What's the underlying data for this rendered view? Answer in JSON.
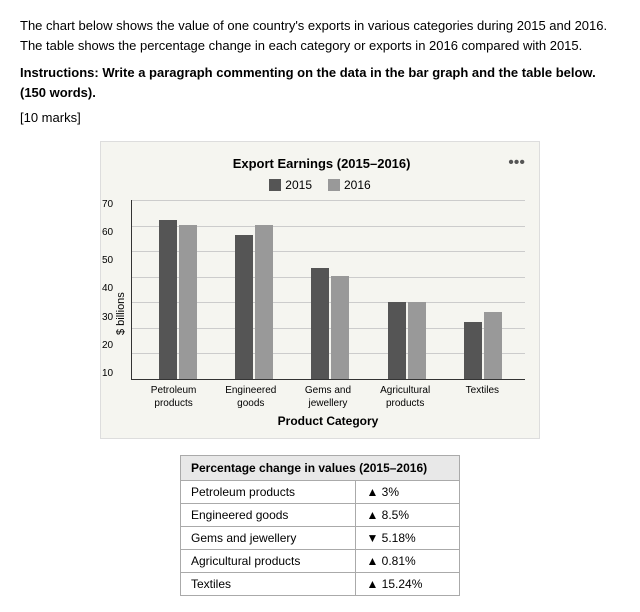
{
  "intro": {
    "description": "The chart below shows the value of one country's exports in various categories during 2015 and 2016. The table shows the percentage change in each category or exports in 2016 compared with 2015.",
    "instructions": "Instructions: Write a paragraph commenting on the data in the bar graph and the table below. (150 words).",
    "marks": "[10 marks]"
  },
  "chart": {
    "title": "Export Earnings (2015–2016)",
    "legend": {
      "y2015": "2015",
      "y2016": "2016"
    },
    "y_axis_label": "$ billions",
    "x_axis_title": "Product Category",
    "y_ticks": [
      "70",
      "60",
      "50",
      "40",
      "30",
      "20",
      "10"
    ],
    "categories": [
      {
        "name": "Petroleum\nproducts",
        "line1": "Petroleum",
        "line2": "products",
        "val2015": 62,
        "val2016": 60
      },
      {
        "name": "Engineered\ngoods",
        "line1": "Engineered",
        "line2": "goods",
        "val2015": 56,
        "val2016": 60
      },
      {
        "name": "Gems and\njewellery",
        "line1": "Gems and",
        "line2": "jewellery",
        "val2015": 43,
        "val2016": 40
      },
      {
        "name": "Agricultural\nproducts",
        "line1": "Agricultural",
        "line2": "products",
        "val2015": 30,
        "val2016": 30
      },
      {
        "name": "Textiles",
        "line1": "Textiles",
        "line2": "",
        "val2015": 22,
        "val2016": 26
      }
    ],
    "max_value": 70
  },
  "table": {
    "header": "Percentage change in values (2015–2016)",
    "rows": [
      {
        "category": "Petroleum products",
        "direction": "up",
        "value": "3%"
      },
      {
        "category": "Engineered goods",
        "direction": "up",
        "value": "8.5%"
      },
      {
        "category": "Gems and jewellery",
        "direction": "down",
        "value": "5.18%"
      },
      {
        "category": "Agricultural products",
        "direction": "up",
        "value": "0.81%"
      },
      {
        "category": "Textiles",
        "direction": "up",
        "value": "15.24%"
      }
    ]
  },
  "menu_icon": "•••"
}
